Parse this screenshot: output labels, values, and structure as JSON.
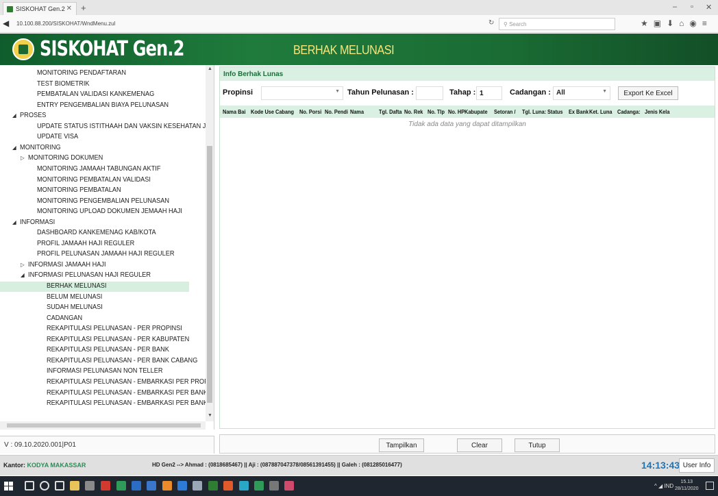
{
  "browser": {
    "tab_title": "SISKOHAT Gen.2",
    "url": "10.100.88.200/SISKOHAT/WndMenu.zul",
    "search_placeholder": "Search"
  },
  "app": {
    "title": "SISKOHAT Gen.2",
    "page_title": "BERHAK MELUNASI"
  },
  "sidebar": {
    "items": [
      {
        "label": "MONITORING PENDAFTARAN",
        "arrow": ""
      },
      {
        "label": "TEST BIOMETRIK",
        "arrow": ""
      },
      {
        "label": "PEMBATALAN VALIDASI KANKEMENAG",
        "arrow": ""
      },
      {
        "label": "ENTRY PENGEMBALIAN BIAYA PELUNASAN",
        "arrow": ""
      },
      {
        "label": "PROSES",
        "arrow": "◢"
      },
      {
        "label": "UPDATE STATUS ISTITHAAH DAN VAKSIN KESEHATAN J",
        "arrow": ""
      },
      {
        "label": "UPDATE VISA",
        "arrow": ""
      },
      {
        "label": "MONITORING",
        "arrow": "◢"
      },
      {
        "label": "MONITORING DOKUMEN",
        "arrow": "▷"
      },
      {
        "label": "MONITORING JAMAAH TABUNGAN AKTIF",
        "arrow": ""
      },
      {
        "label": "MONITORING PEMBATALAN VALIDASI",
        "arrow": ""
      },
      {
        "label": "MONITORING PEMBATALAN",
        "arrow": ""
      },
      {
        "label": "MONITORING PENGEMBALIAN PELUNASAN",
        "arrow": ""
      },
      {
        "label": "MONITORING UPLOAD DOKUMEN JEMAAH HAJI",
        "arrow": ""
      },
      {
        "label": "INFORMASI",
        "arrow": "◢"
      },
      {
        "label": "DASHBOARD KANKEMENAG KAB/KOTA",
        "arrow": ""
      },
      {
        "label": "PROFIL JAMAAH HAJI REGULER",
        "arrow": ""
      },
      {
        "label": "PROFIL PELUNASAN JAMAAH HAJI REGULER",
        "arrow": ""
      },
      {
        "label": "INFORMASI JAMAAH HAJI",
        "arrow": "▷"
      },
      {
        "label": "INFORMASI PELUNASAN HAJI REGULER",
        "arrow": "◢"
      },
      {
        "label": "BERHAK MELUNASI",
        "arrow": ""
      },
      {
        "label": "BELUM MELUNASI",
        "arrow": ""
      },
      {
        "label": "SUDAH MELUNASI",
        "arrow": ""
      },
      {
        "label": "CADANGAN",
        "arrow": ""
      },
      {
        "label": "REKAPITULASI PELUNASAN - PER PROPINSI",
        "arrow": ""
      },
      {
        "label": "REKAPITULASI PELUNASAN - PER KABUPATEN",
        "arrow": ""
      },
      {
        "label": "REKAPITULASI PELUNASAN - PER BANK",
        "arrow": ""
      },
      {
        "label": "REKAPITULASI PELUNASAN - PER BANK CABANG",
        "arrow": ""
      },
      {
        "label": "INFORMASI PELUNASAN NON TELLER",
        "arrow": ""
      },
      {
        "label": "REKAPITULASI PELUNASAN - EMBARKASI PER PROPI",
        "arrow": ""
      },
      {
        "label": "REKAPITULASI PELUNASAN - EMBARKASI PER BANK",
        "arrow": ""
      },
      {
        "label": "REKAPITULASI PELUNASAN - EMBARKASI PER BANK",
        "arrow": ""
      }
    ],
    "selected": "BERHAK MELUNASI",
    "version": "V : 09.10.2020.001|P01"
  },
  "panel": {
    "title": "Info Berhak Lunas",
    "filters": {
      "propinsi_label": "Propinsi",
      "propinsi_value": "",
      "tahun_label": "Tahun Pelunasan :",
      "tahun_value": "",
      "tahap_label": "Tahap :",
      "tahap_value": "1",
      "cadangan_label": "Cadangan :",
      "cadangan_value": "All",
      "export_label": "Export Ke Excel"
    },
    "columns": [
      "Nama Bai",
      "Kode Use",
      "Cabang",
      "No. Porsi",
      "No. Pendi",
      "Nama",
      "Tgl. Dafta",
      "No. Rek",
      "No. Tlp",
      "No. HP",
      "Kabupate",
      "Setoran /",
      "Tgl. Luna:",
      "Status",
      "Ex Bank",
      "Ket. Luna",
      "Cadanga:",
      "Jenis Kela"
    ],
    "rows": [],
    "empty_message": "Tidak ada data yang dapat ditampilkan"
  },
  "buttons": {
    "tampilkan": "Tampilkan",
    "clear": "Clear",
    "tutup": "Tutup"
  },
  "status": {
    "kantor_label": "Kantor:",
    "kantor_value": "KODYA MAKASSAR",
    "hd_info": "HD Gen2 --> Ahmad : (0818685467) || Aji : (087887047378/08561391455) || Galeh : (081285016477)",
    "clock": "14:13:43",
    "user_info": "User Info"
  },
  "taskbar": {
    "tray_lang": "IND",
    "time": "15.13",
    "date": "28/11/2020"
  }
}
